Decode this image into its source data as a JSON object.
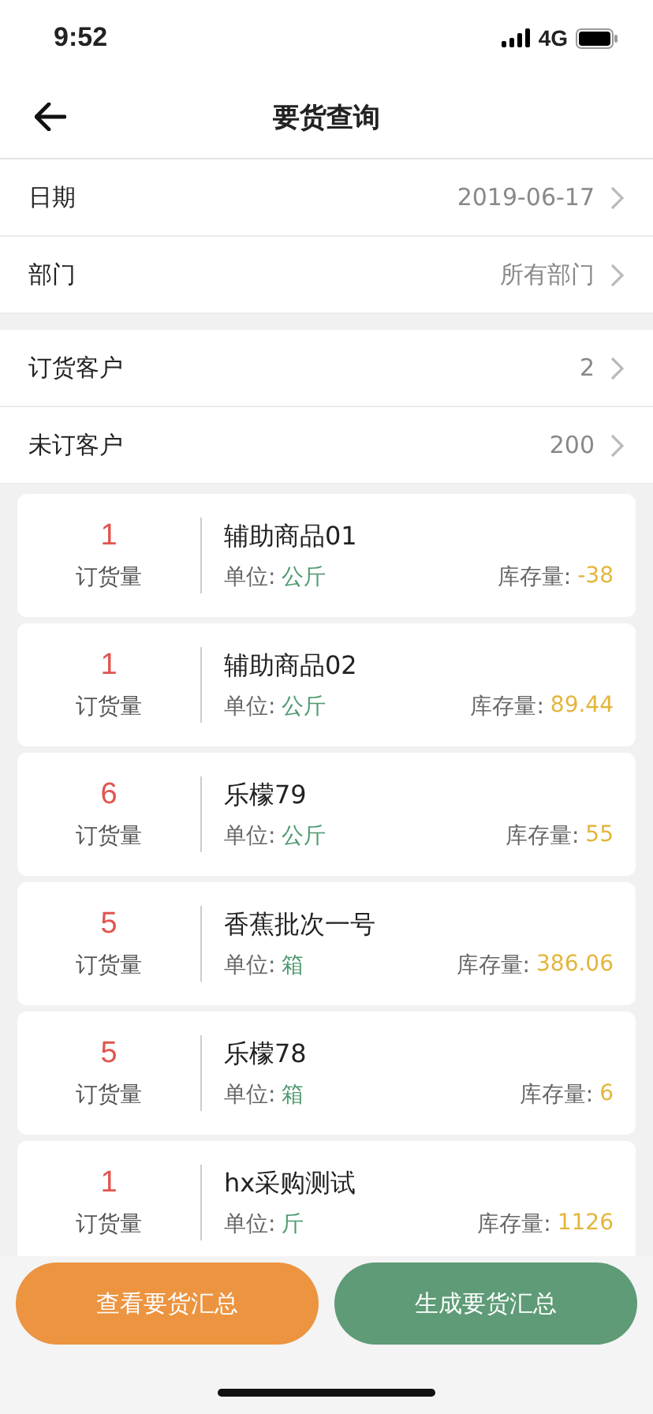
{
  "status_bar": {
    "time": "9:52",
    "network": "4G"
  },
  "nav": {
    "title": "要货查询"
  },
  "filters": [
    {
      "label": "日期",
      "value": "2019-06-17"
    },
    {
      "label": "部门",
      "value": "所有部门"
    }
  ],
  "summary": [
    {
      "label": "订货客户",
      "value": "2"
    },
    {
      "label": "未订客户",
      "value": "200"
    }
  ],
  "products": [
    {
      "quantity": "1",
      "quantity_label": "订货量",
      "name": "辅助商品01",
      "unit_label": "单位:",
      "unit": "公斤",
      "stock_label": "库存量:",
      "stock": "-38"
    },
    {
      "quantity": "1",
      "quantity_label": "订货量",
      "name": "辅助商品02",
      "unit_label": "单位:",
      "unit": "公斤",
      "stock_label": "库存量:",
      "stock": "89.44"
    },
    {
      "quantity": "6",
      "quantity_label": "订货量",
      "name": "乐檬79",
      "unit_label": "单位:",
      "unit": "公斤",
      "stock_label": "库存量:",
      "stock": "55"
    },
    {
      "quantity": "5",
      "quantity_label": "订货量",
      "name": "香蕉批次一号",
      "unit_label": "单位:",
      "unit": "箱",
      "stock_label": "库存量:",
      "stock": "386.06"
    },
    {
      "quantity": "5",
      "quantity_label": "订货量",
      "name": "乐檬78",
      "unit_label": "单位:",
      "unit": "箱",
      "stock_label": "库存量:",
      "stock": "6"
    },
    {
      "quantity": "1",
      "quantity_label": "订货量",
      "name": "hx采购测试",
      "unit_label": "单位:",
      "unit": "斤",
      "stock_label": "库存量:",
      "stock": "1126"
    }
  ],
  "buttons": [
    {
      "label": "查看要货汇总",
      "kind": "orange"
    },
    {
      "label": "生成要货汇总",
      "kind": "green"
    }
  ]
}
